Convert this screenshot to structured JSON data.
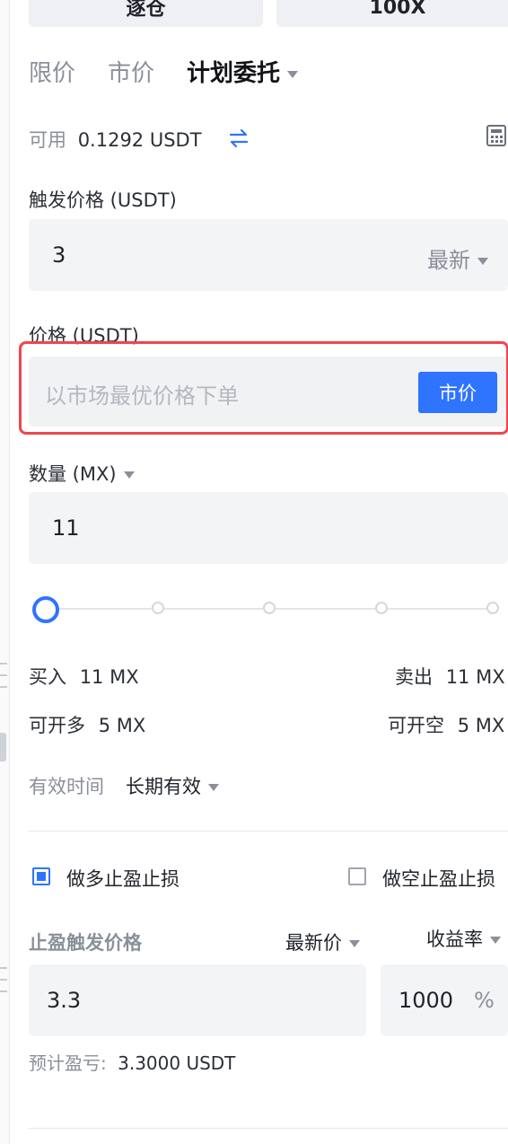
{
  "top_buttons": {
    "margin_mode": "逐仓",
    "leverage": "100X"
  },
  "tabs": [
    {
      "label": "限价"
    },
    {
      "label": "市价"
    },
    {
      "label": "计划委托"
    }
  ],
  "available": {
    "label": "可用",
    "value": "0.1292 USDT"
  },
  "trigger_price": {
    "label": "触发价格 (USDT)",
    "value": "3",
    "type_select": "最新"
  },
  "price": {
    "label": "价格 (USDT)",
    "placeholder": "以市场最优价格下单",
    "market_button": "市价"
  },
  "quantity": {
    "label": "数量 (MX)",
    "value": "11"
  },
  "slider": {
    "value_percent": 0
  },
  "buy": {
    "label": "买入",
    "value": "11 MX"
  },
  "sell": {
    "label": "卖出",
    "value": "11 MX"
  },
  "can_long": {
    "label": "可开多",
    "value": "5 MX"
  },
  "can_short": {
    "label": "可开空",
    "value": "5 MX"
  },
  "validity": {
    "label": "有效时间",
    "value": "长期有效"
  },
  "tp_sl": {
    "long_label": "做多止盈止损",
    "long_checked": true,
    "short_label": "做空止盈止损",
    "short_checked": false
  },
  "take_profit": {
    "label": "止盈触发价格",
    "price_type": "最新价",
    "mode": "收益率",
    "price_value": "3.3",
    "rate_value": "1000",
    "rate_unit": "%",
    "estimate_label": "预计盈亏:",
    "estimate_value": "3.3000 USDT"
  },
  "colors": {
    "accent": "#2f74ff",
    "highlight": "#f0454c"
  }
}
